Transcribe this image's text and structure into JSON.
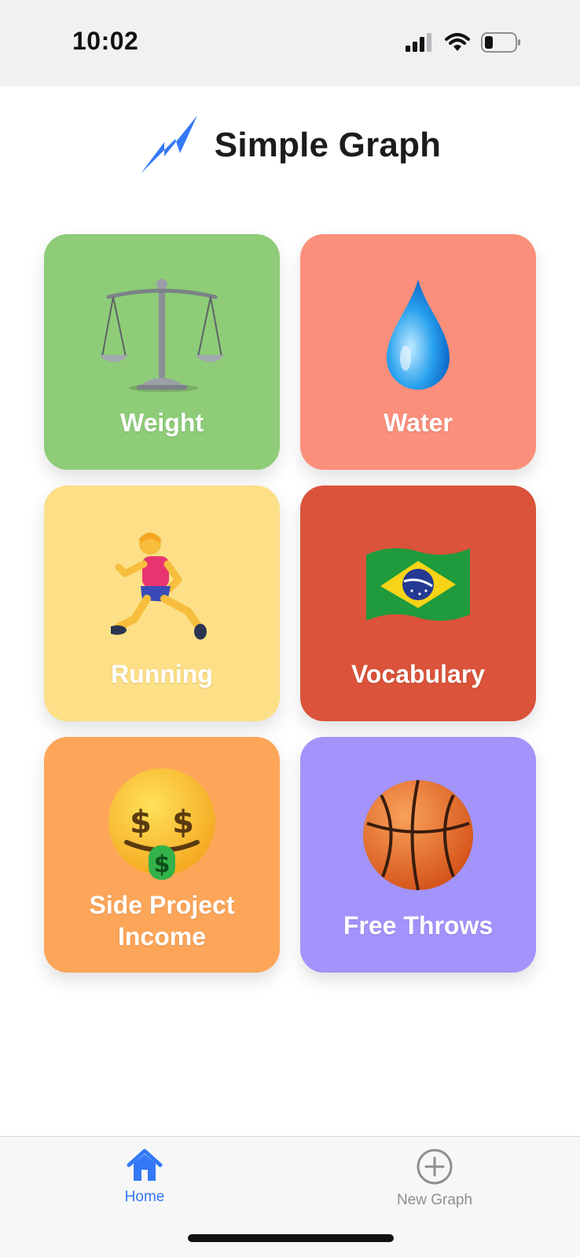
{
  "status_bar": {
    "time": "10:02",
    "icons": [
      "signal-icon",
      "wifi-icon",
      "battery-icon"
    ]
  },
  "header": {
    "title": "Simple Graph",
    "logo_icon": "lightning-graph-icon",
    "logo_color": "#3478f6"
  },
  "tiles": [
    {
      "label": "Weight",
      "icon": "balance-scale-icon",
      "color": "#8ecc78"
    },
    {
      "label": "Water",
      "icon": "water-drop-icon",
      "color": "#fb8f7b"
    },
    {
      "label": "Running",
      "icon": "runner-icon",
      "color": "#fcdf87"
    },
    {
      "label": "Vocabulary",
      "icon": "brazil-flag-icon",
      "color": "#da533a"
    },
    {
      "label": "Side Project\nIncome",
      "icon": "money-mouth-face-icon",
      "color": "#fda65a"
    },
    {
      "label": "Free Throws",
      "icon": "basketball-icon",
      "color": "#a294fb"
    }
  ],
  "tab_bar": {
    "items": [
      {
        "label": "Home",
        "icon": "home-icon",
        "active": true
      },
      {
        "label": "New Graph",
        "icon": "plus-circle-icon",
        "active": false
      }
    ],
    "active_color": "#3478f6",
    "inactive_color": "#8e8e93"
  }
}
